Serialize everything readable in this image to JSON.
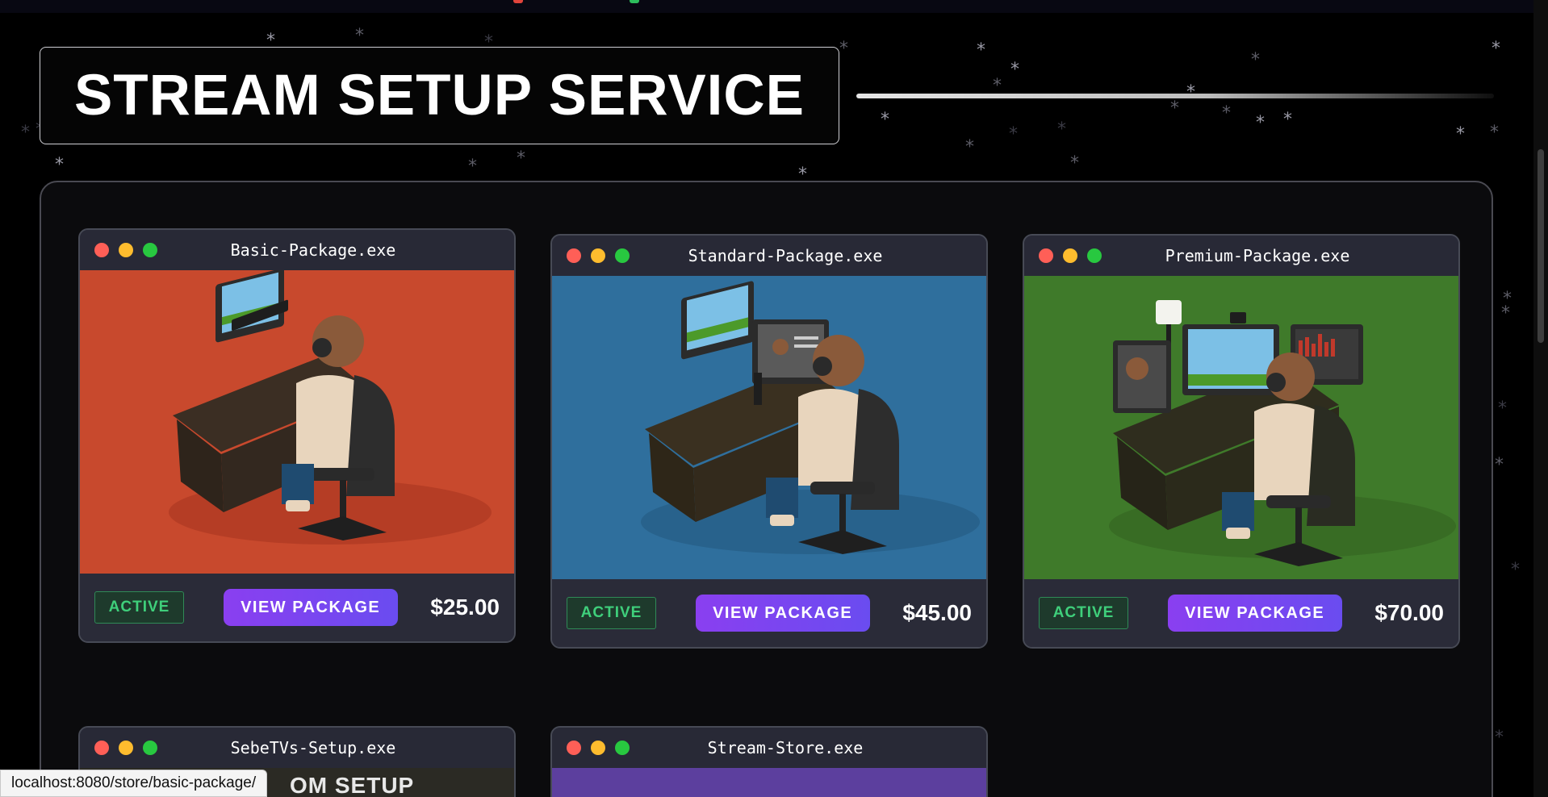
{
  "page": {
    "title": "STREAM SETUP SERVICE"
  },
  "cards": [
    {
      "file": "Basic-Package.exe",
      "status": "ACTIVE",
      "action": "VIEW PACKAGE",
      "price": "$25.00",
      "image_color": "#c8492d"
    },
    {
      "file": "Standard-Package.exe",
      "status": "ACTIVE",
      "action": "VIEW PACKAGE",
      "price": "$45.00",
      "image_color": "#2f6f9d"
    },
    {
      "file": "Premium-Package.exe",
      "status": "ACTIVE",
      "action": "VIEW PACKAGE",
      "price": "$70.00",
      "image_color": "#3f7a2a"
    },
    {
      "file": "SebeTVs-Setup.exe",
      "image_color": "#2b2a24",
      "partial_text": "OM SETUP"
    },
    {
      "file": "Stream-Store.exe",
      "image_color": "#5c3f9e"
    }
  ],
  "status_bar": {
    "url": "localhost:8080/store/basic-package/"
  },
  "colors": {
    "accent_button": "#8a3ff0",
    "badge_green": "#3fcf7b",
    "panel_border": "#4a4a52"
  }
}
